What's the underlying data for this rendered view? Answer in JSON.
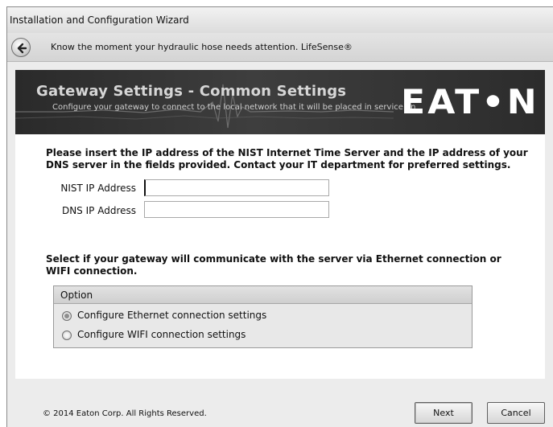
{
  "window": {
    "title": "Installation and Configuration Wizard"
  },
  "nav": {
    "back_icon": "back-arrow-icon",
    "message": "Know the moment your hydraulic hose needs attention.  LifeSense®"
  },
  "banner": {
    "title": "Gateway Settings - Common Settings",
    "subtitle": "Configure your gateway to connect to the local network that it will be placed in service on",
    "logo_text": "EAT•N"
  },
  "form": {
    "instructions": "Please insert the IP address of the NIST Internet Time Server and the IP address of your DNS server in the fields provided.  Contact your IT department for preferred settings.",
    "nist_label": "NIST IP Address",
    "nist_value": "",
    "dns_label": "DNS IP Address",
    "dns_value": ""
  },
  "connection": {
    "prompt": "Select if your gateway will communicate with the server via Ethernet connection or WIFI connection.",
    "header": "Option",
    "options": [
      {
        "label": "Configure Ethernet connection settings",
        "selected": true
      },
      {
        "label": "Configure WIFI connection settings",
        "selected": false
      }
    ]
  },
  "footer": {
    "copyright": "© 2014 Eaton Corp.  All Rights Reserved.",
    "next_label": "Next",
    "cancel_label": "Cancel"
  }
}
